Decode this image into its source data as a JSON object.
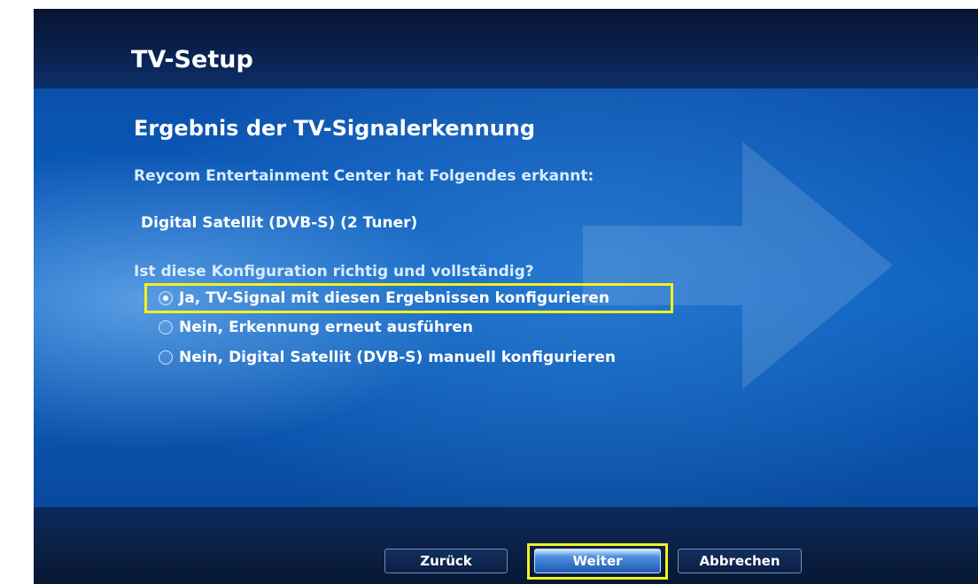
{
  "header": {
    "title": "TV-Setup"
  },
  "main": {
    "heading": "Ergebnis der TV-Signalerkennung",
    "subtitle": "Reycom Entertainment Center hat Folgendes erkannt:",
    "detected": "Digital Satellit (DVB-S) (2 Tuner)",
    "question": "Ist diese Konfiguration richtig und vollständig?",
    "options": [
      {
        "label": "Ja, TV-Signal mit diesen Ergebnissen konfigurieren",
        "selected": true
      },
      {
        "label": "Nein, Erkennung erneut ausführen",
        "selected": false
      },
      {
        "label": "Nein, Digital Satellit (DVB-S) manuell konfigurieren",
        "selected": false
      }
    ]
  },
  "footer": {
    "back_label": "Zurück",
    "next_label": "Weiter",
    "cancel_label": "Abbrechen"
  },
  "colors": {
    "highlight": "#f2f21e",
    "background": "#0b60c0"
  }
}
